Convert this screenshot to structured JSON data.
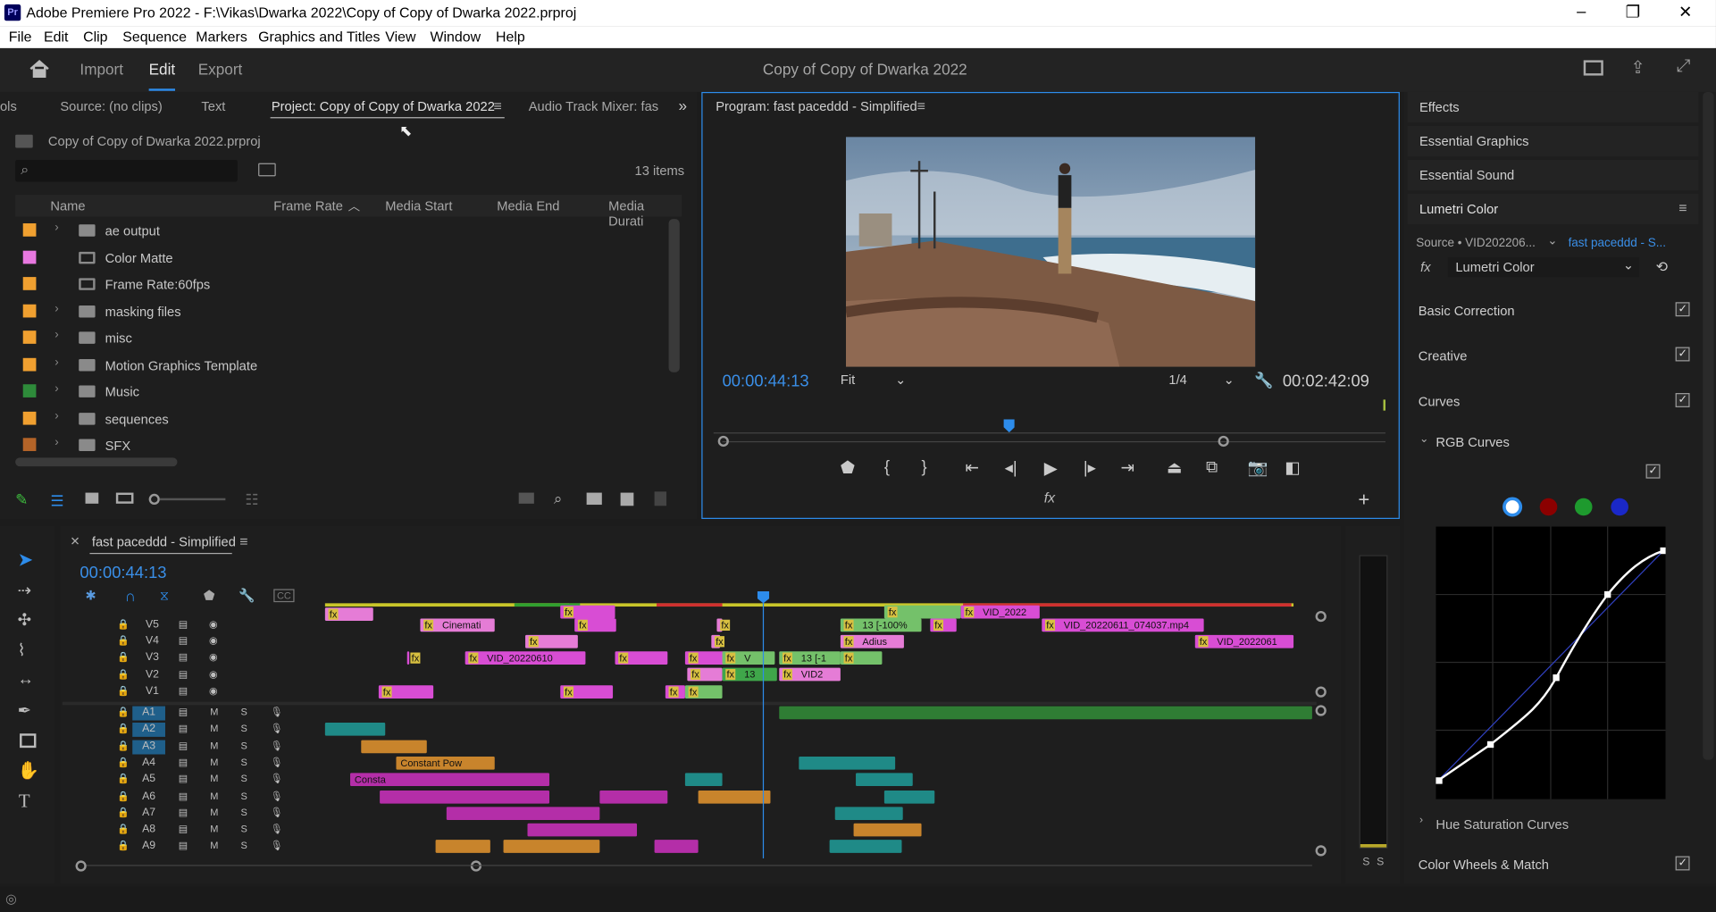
{
  "window": {
    "title": "Adobe Premiere Pro 2022 - F:\\Vikas\\Dwarka 2022\\Copy of Copy of Dwarka 2022.prproj",
    "app_badge": "Pr",
    "minimize": "–",
    "restore": "❐",
    "close": "✕"
  },
  "menu": [
    "File",
    "Edit",
    "Clip",
    "Sequence",
    "Markers",
    "Graphics and Titles",
    "View",
    "Window",
    "Help"
  ],
  "header": {
    "workspaces": [
      "Import",
      "Edit",
      "Export"
    ],
    "active_workspace": "Edit",
    "project_title": "Copy of Copy of Dwarka 2022"
  },
  "project_panel": {
    "tabs": [
      "ols",
      "Source: (no clips)",
      "Text",
      "Project: Copy of Copy of Dwarka 2022",
      "Audio Track Mixer: fas"
    ],
    "active_tab": "Project: Copy of Copy of Dwarka 2022",
    "file": "Copy of Copy of Dwarka 2022.prproj",
    "search_placeholder": "",
    "item_count": "13 items",
    "columns": [
      "Name",
      "Frame Rate",
      "Media Start",
      "Media End",
      "Media Durati"
    ],
    "items": [
      {
        "name": "ae output",
        "color": "#f0a030",
        "type": "folder"
      },
      {
        "name": "Color Matte",
        "color": "#e878e0",
        "type": "matte"
      },
      {
        "name": "Frame Rate:60fps",
        "color": "#f0a030",
        "type": "sequence"
      },
      {
        "name": "masking files",
        "color": "#f0a030",
        "type": "folder"
      },
      {
        "name": "misc",
        "color": "#f0a030",
        "type": "folder"
      },
      {
        "name": "Motion Graphics Template",
        "color": "#f0a030",
        "type": "folder"
      },
      {
        "name": "Music",
        "color": "#2e8b3a",
        "type": "folder"
      },
      {
        "name": "sequences",
        "color": "#f0a030",
        "type": "folder"
      },
      {
        "name": "SFX",
        "color": "#b46428",
        "type": "folder"
      }
    ]
  },
  "program_monitor": {
    "title": "Program: fast paceddd - Simplified",
    "timecode": "00:00:44:13",
    "fit": "Fit",
    "resolution": "1/4",
    "duration": "00:02:42:09",
    "playhead_fraction": 0.44
  },
  "right_panel": {
    "items": [
      "Effects",
      "Essential Graphics",
      "Essential Sound",
      "Lumetri Color"
    ],
    "source_label": "Source • VID202206...",
    "target_label": "fast paceddd - S...",
    "effect_select": "Lumetri Color",
    "sections": [
      {
        "label": "Basic Correction",
        "checked": true
      },
      {
        "label": "Creative",
        "checked": true
      },
      {
        "label": "Curves",
        "checked": true
      }
    ],
    "rgb_curves": "RGB Curves",
    "hue_sat": "Hue Saturation Curves",
    "color_wheels": "Color Wheels & Match",
    "channel_colors": [
      "#ffffff",
      "#8b0000",
      "#1e9a2e",
      "#1a28c8"
    ]
  },
  "timeline": {
    "sequence_name": "fast paceddd - Simplified",
    "timecode": "00:00:44:13",
    "video_tracks": [
      "V5",
      "V4",
      "V3",
      "V2",
      "V1"
    ],
    "audio_tracks": [
      "A1",
      "A2",
      "A3",
      "A4",
      "A5",
      "A6",
      "A7",
      "A8",
      "A9"
    ],
    "mute_label": "M",
    "solo_label": "S",
    "clip_labels": {
      "v5_a": "Cinemati",
      "v5_b": "13 [-100%",
      "v5_c": "VID_20220611_074037.mp4",
      "v5_top": "VID_2022",
      "v4_a": "Adius",
      "v4_b": "VID_2022061",
      "v3_a": "VID_20220610",
      "v3_b": "V",
      "v3_c": "13 [-1",
      "v2_a": "13",
      "v2_b": "VID2"
    },
    "audio_clip_labels": [
      "Consta",
      "Constant Pow"
    ],
    "meter_labels": [
      "S",
      "S"
    ]
  },
  "tools": [
    "selection",
    "track-select",
    "ripple",
    "razor",
    "slip",
    "pen",
    "rectangle",
    "hand",
    "type"
  ]
}
